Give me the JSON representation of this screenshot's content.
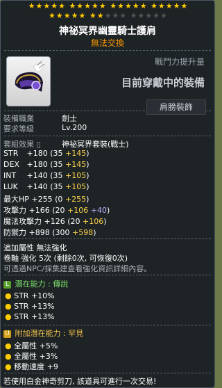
{
  "stars": {
    "row1_filled": 20,
    "row1_total": 20,
    "row2_filled": 7,
    "row2_total": 15
  },
  "item": {
    "name": "神祕冥界幽靈騎士護肩",
    "trade_status": "無法交換"
  },
  "power": {
    "label": "戰鬥力提升量",
    "main_text": "目前穿戴中的裝備"
  },
  "requirements": {
    "job_label": "裝備職業",
    "job_value": "劍士",
    "level_label": "要求等級",
    "level_value": "Lv.200",
    "category": "肩膀裝飾"
  },
  "set_effect": {
    "label": "套組效果",
    "set_name": "神祕冥界套裝(戰士)"
  },
  "stats": [
    {
      "name": "STR",
      "total": "+180",
      "base": "35",
      "bonus": "+145",
      "extra": ""
    },
    {
      "name": "DEX",
      "total": "+180",
      "base": "35",
      "bonus": "+145",
      "extra": ""
    },
    {
      "name": "INT",
      "total": "+140",
      "base": "35",
      "bonus": "+105",
      "extra": ""
    },
    {
      "name": "LUK",
      "total": "+140",
      "base": "35",
      "bonus": "+105",
      "extra": ""
    },
    {
      "name": "最大HP",
      "total": "+255",
      "base": "0",
      "bonus": "+255",
      "extra": ""
    },
    {
      "name": "攻擊力",
      "total": "+166",
      "base": "20",
      "bonus": "+106",
      "extra": "+40"
    },
    {
      "name": "魔法攻擊力",
      "total": "+126",
      "base": "20",
      "bonus": "+106",
      "extra": ""
    },
    {
      "name": "防禦力",
      "total": "+898",
      "base": "300",
      "bonus": "+598",
      "extra": ""
    }
  ],
  "extra_attr": {
    "label": "追加屬性",
    "value": "無法強化"
  },
  "scroll": {
    "label": "卷軸",
    "value": "強化 5次 (剩餘0次, 可恢復0次)"
  },
  "npc_hint": "可透過NPC/採集建查看強化資訊詳細內容。",
  "potential": {
    "badge": "L",
    "title": "潛在能力 : 傳說",
    "lines": [
      "STR +10%",
      "STR +13%",
      "STR +13%"
    ]
  },
  "bonus_potential": {
    "badge": "U",
    "title": "附加潛在能力 : 罕見",
    "lines": [
      "全屬性 +5%",
      "全屬性 +3%",
      "移動速度 +9"
    ]
  },
  "footer": "若使用白金神奇剪刀, 該道具可進行一次交易!",
  "colors": {
    "star_filled": "#ffcc00",
    "star_empty": "#555555",
    "bonus_yellow": "#ffd54a",
    "bonus_purple": "#b9b4ff",
    "trade_orange": "#ff9a00"
  }
}
